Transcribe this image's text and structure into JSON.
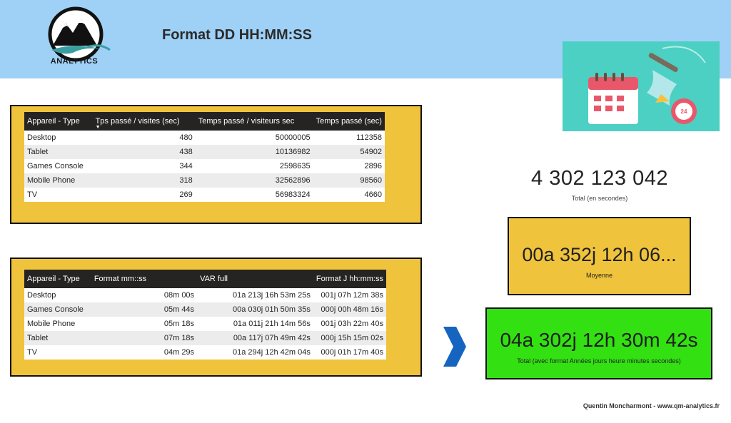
{
  "header": {
    "logo_text": "ANALYTICS",
    "title": "Format DD HH:MM:SS"
  },
  "table1": {
    "columns": [
      "Appareil - Type",
      "Tps passé / visites (sec)",
      "Temps passé / visiteurs sec",
      "Temps passé (sec)"
    ],
    "rows": [
      [
        "Desktop",
        "480",
        "50000005",
        "112358"
      ],
      [
        "Tablet",
        "438",
        "10136982",
        "54902"
      ],
      [
        "Games Console",
        "344",
        "2598635",
        "2896"
      ],
      [
        "Mobile Phone",
        "318",
        "32562896",
        "98560"
      ],
      [
        "TV",
        "269",
        "56983324",
        "4660"
      ]
    ]
  },
  "table2": {
    "columns": [
      "Appareil - Type",
      "Format mm::ss",
      "VAR full",
      "Format J hh:mm:ss"
    ],
    "rows": [
      [
        "Desktop",
        "08m 00s",
        "01a 213j 16h 53m 25s",
        "001j 07h 12m 38s"
      ],
      [
        "Games Console",
        "05m 44s",
        "00a 030j 01h 50m 35s",
        "000j 00h 48m 16s"
      ],
      [
        "Mobile Phone",
        "05m 18s",
        "01a 011j 21h 14m 56s",
        "001j 03h 22m 40s"
      ],
      [
        "Tablet",
        "07m 18s",
        "00a 117j 07h 49m 42s",
        "000j 15h 15m 02s"
      ],
      [
        "TV",
        "04m 29s",
        "01a 294j 12h 42m 04s",
        "000j 01h 17m 40s"
      ]
    ]
  },
  "total_seconds": {
    "value": "4 302 123 042",
    "label": "Total (en secondes)"
  },
  "average_card": {
    "value": "00a 352j 12h 06...",
    "label": "Moyenne"
  },
  "total_card": {
    "value": "04a 302j 12h 30m 42s",
    "label": "Total (avec format Années jours heure minutes secondes)"
  },
  "footer": {
    "credit": "Quentin Moncharmont - www.qm-analytics.fr"
  },
  "icons": {
    "logo": "mountain-logo-icon",
    "illustration": "calendar-hourglass-icon",
    "arrow": "chevron-right-icon"
  },
  "colors": {
    "header_band": "#9fd1f7",
    "frame_fill": "#f0c33c",
    "table_header": "#252423",
    "total_card": "#33e012",
    "illustration_bg": "#4bd0c3",
    "chevron": "#1565c0"
  }
}
